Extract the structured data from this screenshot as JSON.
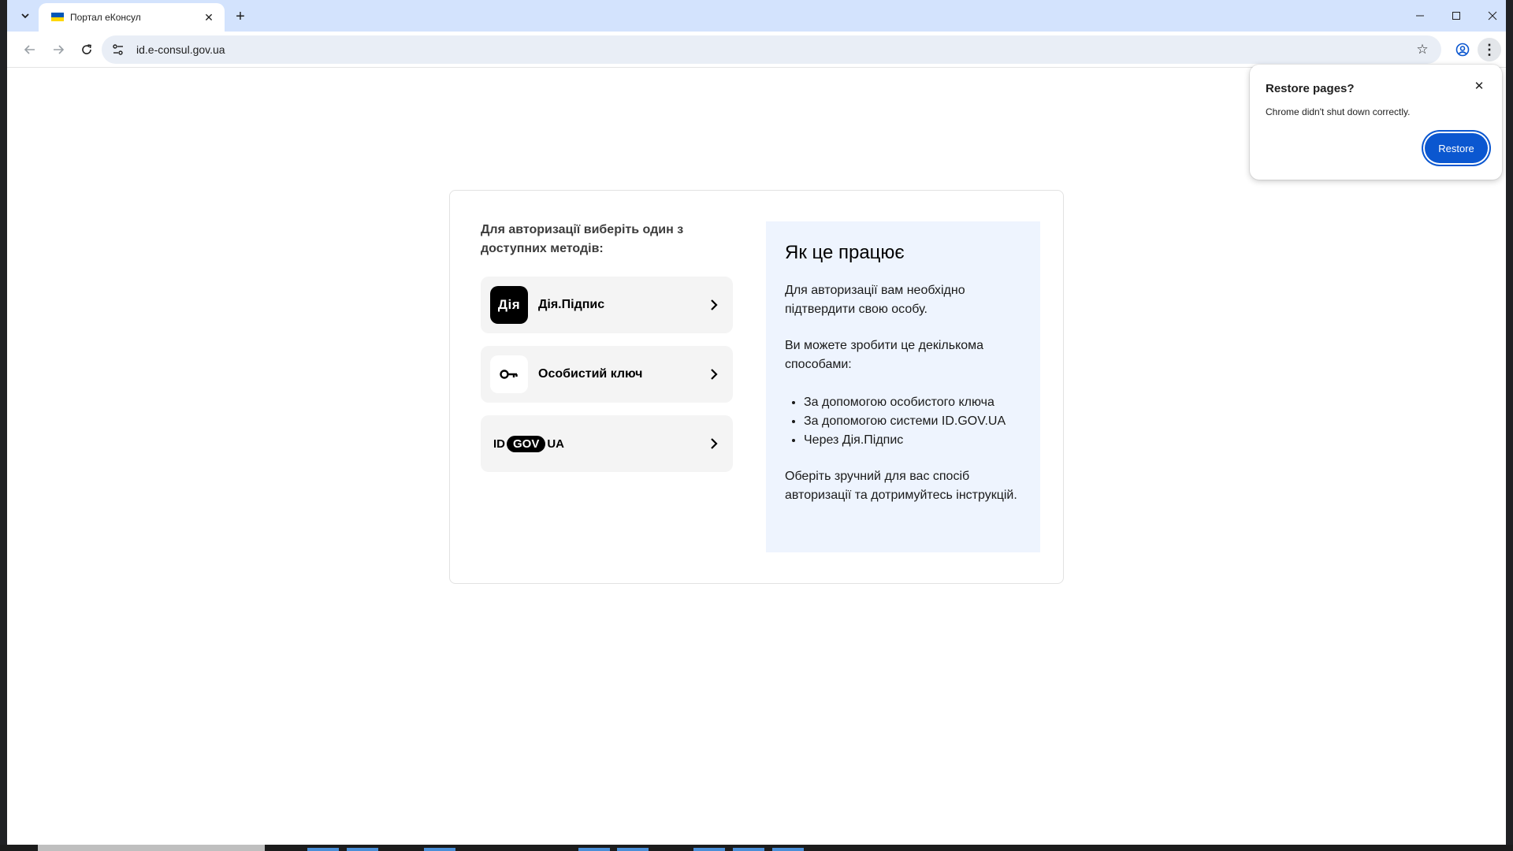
{
  "browser": {
    "tab_title": "Портал еКонсул",
    "new_tab_label": "+",
    "url": "id.e-consul.gov.ua"
  },
  "page": {
    "intro": "Для авторизації виберіть один з доступних методів:",
    "methods": [
      {
        "label": "Дія.Підпис",
        "icon_text": "Дія",
        "icon": "diia-logo-icon"
      },
      {
        "label": "Особистий ключ",
        "icon": "key-icon"
      },
      {
        "label": "",
        "logo": {
          "left": "ID",
          "pill": "GOV",
          "right": "UA"
        },
        "icon": "id-gov-ua-logo"
      }
    ],
    "how": {
      "title": "Як це працює",
      "p1": "Для авторизації вам необхідно підтвердити свою особу.",
      "p2": "Ви можете зробити це декількома способами:",
      "bullets": [
        "За допомогою особистого ключа",
        "За допомогою системи ID.GOV.UA",
        "Через Дія.Підпис"
      ],
      "p3": "Оберіть зручний для вас спосіб авторизації та дотримуйтесь інструкцій."
    }
  },
  "restore_popup": {
    "title": "Restore pages?",
    "text": "Chrome didn't shut down correctly.",
    "button": "Restore"
  },
  "colors": {
    "tabstrip": "#d3e3fd",
    "accent_button": "#0b57d0",
    "info_panel": "#eef4fe"
  }
}
